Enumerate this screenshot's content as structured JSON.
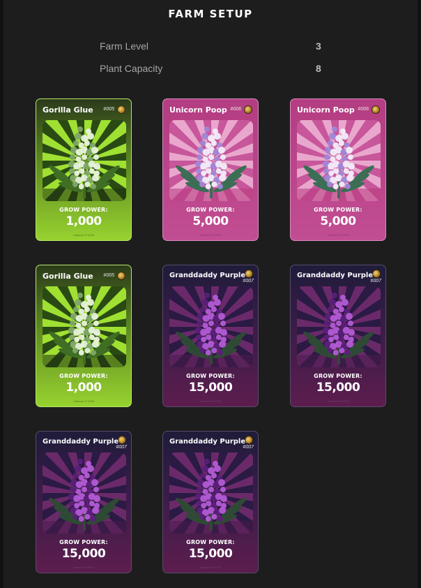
{
  "title": "FARM SETUP",
  "stats": [
    {
      "label": "Farm Level",
      "value": "3"
    },
    {
      "label": "Plant Capacity",
      "value": "8"
    }
  ],
  "cards": [
    {
      "name": "Gorilla Glue",
      "number": "#005",
      "grow_power_label": "GROW POWER:",
      "grow_power": "1,000",
      "footer": "Kabloom ® 2025",
      "strain": "gorilla"
    },
    {
      "name": "Unicorn Poop",
      "number": "#006",
      "grow_power_label": "GROW POWER:",
      "grow_power": "5,000",
      "footer": "Kabloom ® 2025",
      "strain": "unicorn"
    },
    {
      "name": "Unicorn Poop",
      "number": "#006",
      "grow_power_label": "GROW POWER:",
      "grow_power": "5,000",
      "footer": "Kabloom ® 2025",
      "strain": "unicorn"
    },
    {
      "name": "Gorilla Glue",
      "number": "#005",
      "grow_power_label": "GROW POWER:",
      "grow_power": "1,000",
      "footer": "Kabloom ® 2025",
      "strain": "gorilla"
    },
    {
      "name": "Granddaddy Purple",
      "number": "#007",
      "grow_power_label": "GROW POWER:",
      "grow_power": "15,000",
      "footer": "Kabloom ® 2025",
      "strain": "purple"
    },
    {
      "name": "Granddaddy Purple",
      "number": "#007",
      "grow_power_label": "GROW POWER:",
      "grow_power": "15,000",
      "footer": "Kabloom ® 2025",
      "strain": "purple"
    },
    {
      "name": "Granddaddy Purple",
      "number": "#007",
      "grow_power_label": "GROW POWER:",
      "grow_power": "15,000",
      "footer": "Kabloom ® 2025",
      "strain": "purple"
    },
    {
      "name": "Granddaddy Purple",
      "number": "#007",
      "grow_power_label": "GROW POWER:",
      "grow_power": "15,000",
      "footer": "Kabloom ® 2025",
      "strain": "purple"
    }
  ],
  "colors": {
    "background": "#1d1d1d",
    "gorilla_accent": "#97d22f",
    "unicorn_accent": "#c14d92",
    "purple_accent": "#5c1d4e"
  },
  "icons": {
    "card_badge": "coin-icon",
    "card_art": "cannabis-bud-icon"
  }
}
